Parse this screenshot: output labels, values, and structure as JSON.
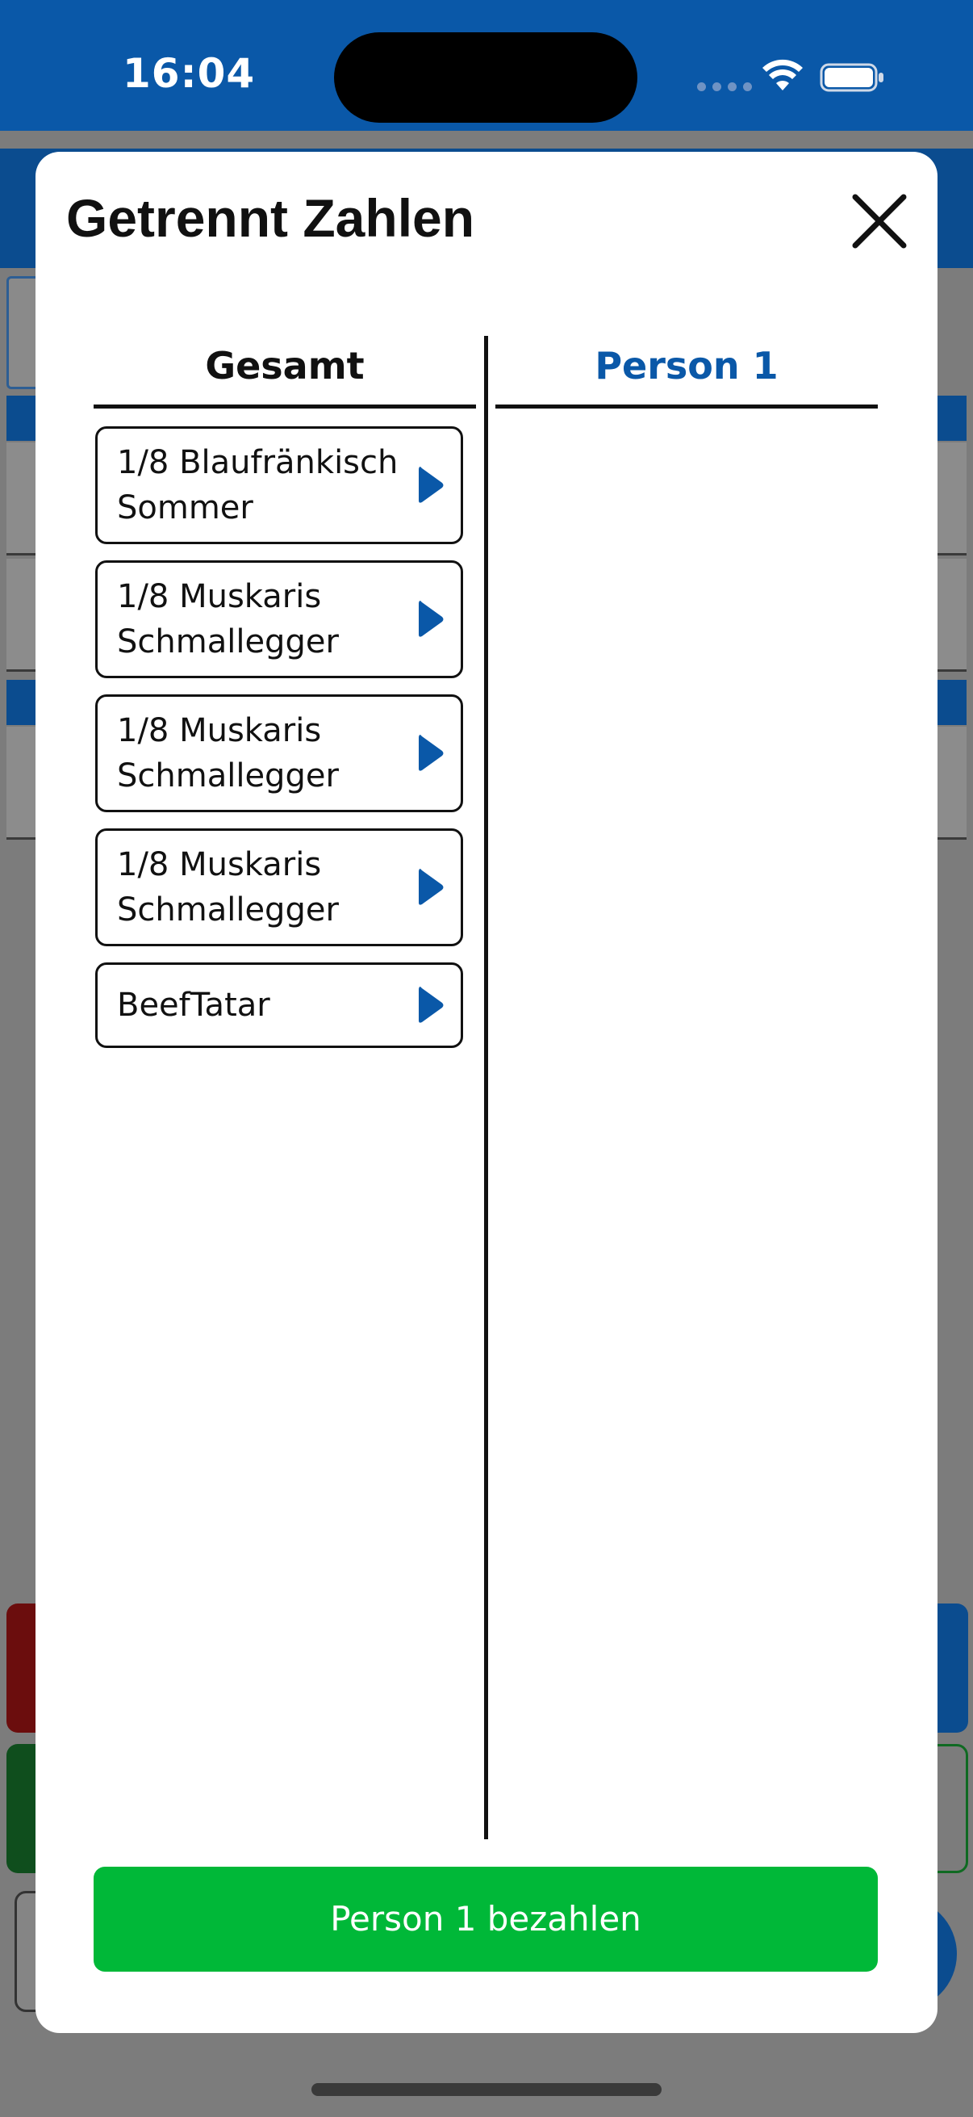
{
  "status_bar": {
    "time": "16:04",
    "icons": [
      "signal-dots-icon",
      "wifi-icon",
      "battery-icon"
    ]
  },
  "colors": {
    "brand_blue": "#0a58a8",
    "pay_green": "#00b838",
    "text_dark": "#111111",
    "overlay_gray": "#7c7c7c"
  },
  "modal": {
    "title": "Getrennt Zahlen",
    "close_icon": "close-icon",
    "columns": {
      "left_header": "Gesamt",
      "right_header": "Person 1"
    },
    "items": [
      {
        "label": "1/8 Blaufränkisch Sommer",
        "icon": "chevron-right-icon"
      },
      {
        "label": "1/8 Muskaris Schmallegger",
        "icon": "chevron-right-icon"
      },
      {
        "label": "1/8 Muskaris Schmallegger",
        "icon": "chevron-right-icon"
      },
      {
        "label": "1/8 Muskaris Schmallegger",
        "icon": "chevron-right-icon"
      },
      {
        "label": "BeefTatar",
        "icon": "chevron-right-icon"
      }
    ],
    "person_items": [],
    "pay_button_label": "Person 1 bezahlen"
  }
}
